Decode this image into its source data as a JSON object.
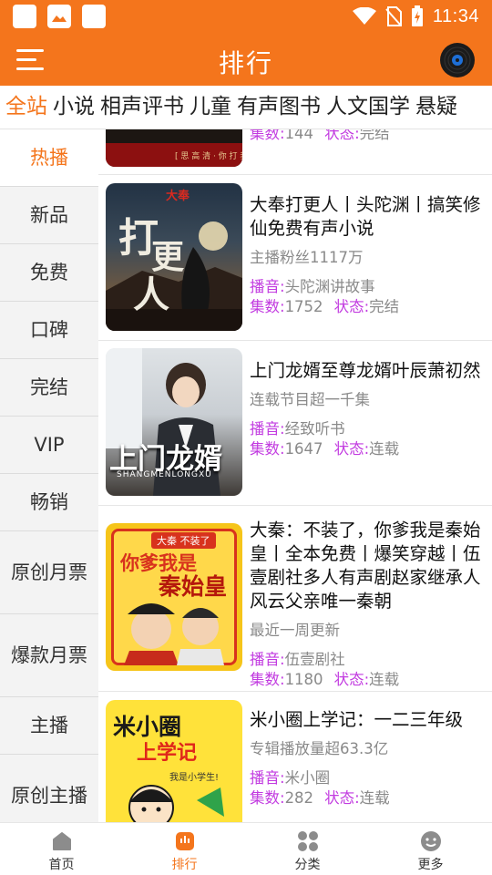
{
  "status_bar": {
    "time": "11:34",
    "colors": {
      "bar": "#f4751c"
    }
  },
  "header": {
    "title": "排行",
    "menu_icon": "hamburger-menu-icon",
    "right_icon": "vinyl-record-icon"
  },
  "tabs": [
    {
      "label": "全站",
      "active": true
    },
    {
      "label": "小说"
    },
    {
      "label": "相声评书"
    },
    {
      "label": "儿童"
    },
    {
      "label": "有声图书"
    },
    {
      "label": "人文国学"
    },
    {
      "label": "悬疑"
    }
  ],
  "sidebar": [
    {
      "label": "热播",
      "active": true
    },
    {
      "label": "新品"
    },
    {
      "label": "免费"
    },
    {
      "label": "口碑"
    },
    {
      "label": "完结"
    },
    {
      "label": "VIP"
    },
    {
      "label": "畅销"
    },
    {
      "label": "原创月票"
    },
    {
      "label": "爆款月票"
    },
    {
      "label": "主播"
    },
    {
      "label": "原创主播"
    }
  ],
  "labels": {
    "broadcaster": "播音:",
    "episodes": "集数:",
    "status": "状态:"
  },
  "books": [
    {
      "title": "",
      "subtitle": "",
      "broadcaster": "",
      "episodes": "144",
      "status": "完结",
      "cover_text": [
        "[ 思 高 清 · 你 打 我 ]"
      ]
    },
    {
      "title": "大奉打更人丨头陀渊丨搞笑修仙免费有声小说",
      "subtitle": "主播粉丝1117万",
      "broadcaster": "头陀渊讲故事",
      "episodes": "1752",
      "status": "完结",
      "cover_text": [
        "大奉",
        "打",
        "更",
        "人"
      ]
    },
    {
      "title": "上门龙婿至尊龙婿叶辰萧初然",
      "subtitle": "连载节目超一千集",
      "broadcaster": "经致听书",
      "episodes": "1647",
      "status": "连载",
      "cover_text": [
        "上门龙婿",
        "SHANGMENLONGXU"
      ]
    },
    {
      "title": "大秦：不装了，你爹我是秦始皇丨全本免费丨爆笑穿越丨伍壹剧社多人有声剧赵家继承人风云父亲唯一秦朝",
      "subtitle": "最近一周更新",
      "broadcaster": "伍壹剧社",
      "episodes": "1180",
      "status": "连载",
      "cover_text": [
        "大秦 不装了",
        "你爹我是",
        "秦始皇"
      ]
    },
    {
      "title": "米小圈上学记：一二三年级",
      "subtitle": "专辑播放量超63.3亿",
      "broadcaster": "米小圈",
      "episodes": "282",
      "status": "连载",
      "cover_text": [
        "米小圈",
        "上学记",
        "我是小学生!"
      ]
    }
  ],
  "bottom_nav": [
    {
      "label": "首页",
      "icon": "home-icon"
    },
    {
      "label": "排行",
      "icon": "ranking-icon",
      "active": true
    },
    {
      "label": "分类",
      "icon": "category-grid-icon"
    },
    {
      "label": "更多",
      "icon": "more-smiley-icon"
    }
  ]
}
